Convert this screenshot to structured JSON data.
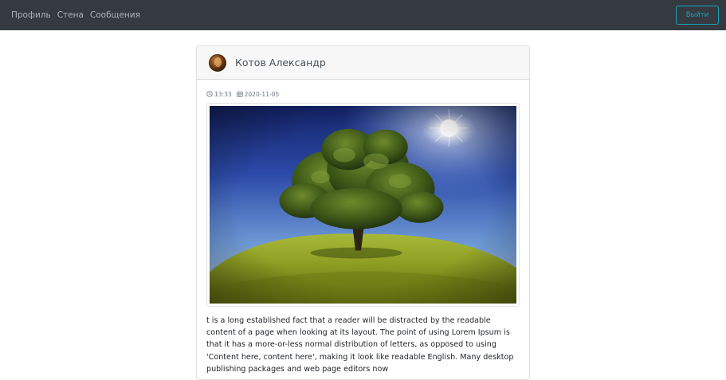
{
  "navbar": {
    "links": [
      "Профиль",
      "Стена",
      "Сообщения"
    ],
    "logout_label": "Выйти"
  },
  "post": {
    "author": "Котов Александр",
    "time": "13:33",
    "date": "2020-11-05",
    "text": "t is a long established fact that a reader will be distracted by the readable content of a page when looking at its layout. The point of using Lorem Ipsum is that it has a more-or-less normal distribution of letters, as opposed to using 'Content here, content here', making it look like readable English. Many desktop publishing packages and web page editors now"
  },
  "colors": {
    "navbar_bg": "#343a40",
    "accent": "#17a2b8"
  },
  "icons": {
    "time": "clock-icon",
    "date": "calendar-icon"
  }
}
